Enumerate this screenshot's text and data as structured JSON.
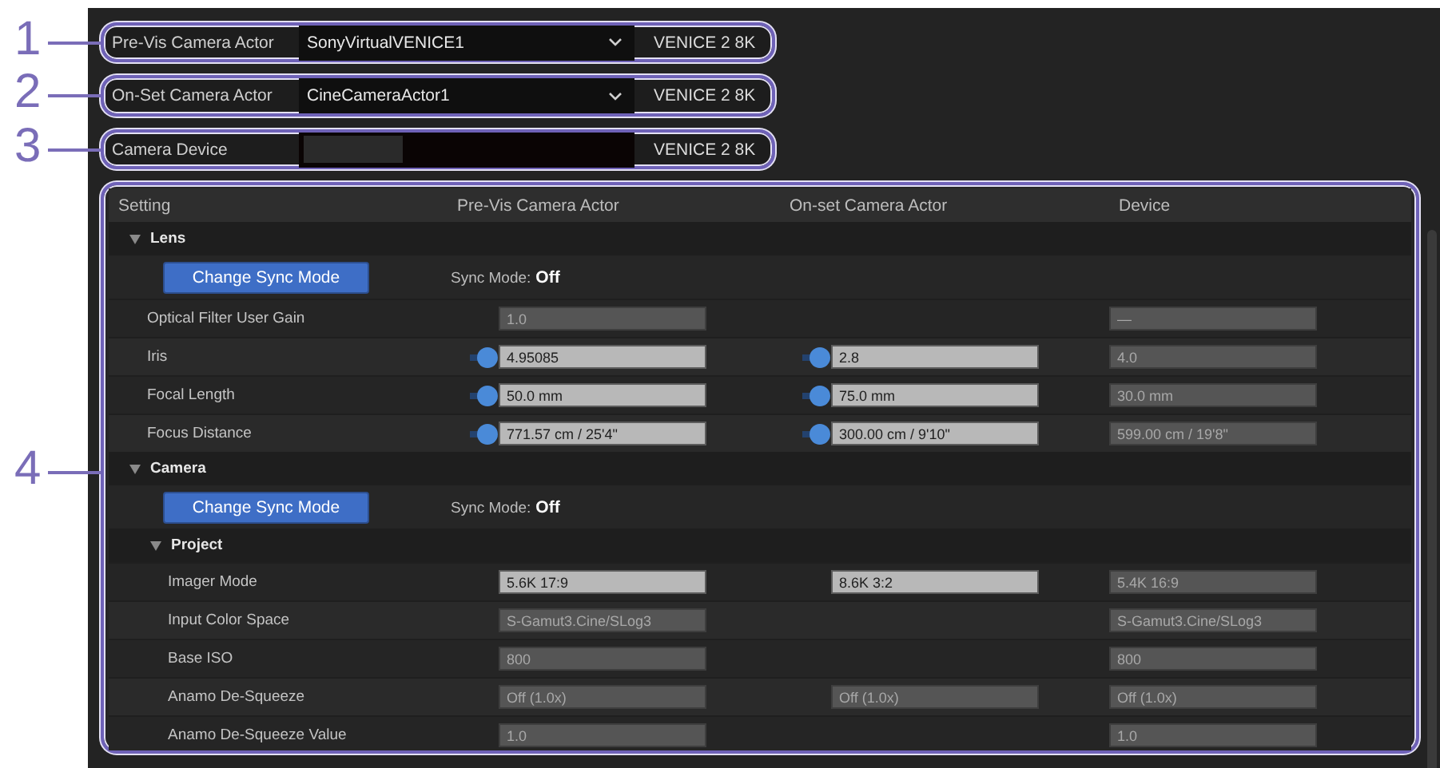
{
  "top_rows": [
    {
      "callout": "1",
      "label": "Pre-Vis Camera Actor",
      "kind": "dropdown",
      "value": "SonyVirtualVENICE1",
      "model": "VENICE 2 8K"
    },
    {
      "callout": "2",
      "label": "On-Set Camera Actor",
      "kind": "dropdown",
      "value": "CineCameraActor1",
      "model": "VENICE 2 8K"
    },
    {
      "callout": "3",
      "label": "Camera Device",
      "kind": "device_picker",
      "model": "VENICE 2 8K"
    }
  ],
  "table": {
    "callout": "4",
    "columns": [
      "Setting",
      "Pre-Vis Camera Actor",
      "On-set Camera Actor",
      "Device"
    ],
    "groups": [
      {
        "title": "Lens",
        "expanded": true,
        "items": [
          {
            "kind": "sync",
            "button": "Change Sync Mode",
            "label": "Sync Mode:",
            "value": "Off"
          },
          {
            "kind": "row",
            "label": "Optical Filter User Gain",
            "pre_vis": {
              "kind": "field",
              "value": "1.0",
              "editable": false
            },
            "device": {
              "kind": "field",
              "value": "—",
              "editable": false
            }
          },
          {
            "kind": "row",
            "label": "Iris",
            "pre_vis": {
              "kind": "slider_field",
              "value": "4.95085",
              "editable": true
            },
            "on_set": {
              "kind": "slider_field",
              "value": "2.8",
              "editable": true
            },
            "device": {
              "kind": "field",
              "value": "4.0",
              "editable": false
            }
          },
          {
            "kind": "row",
            "label": "Focal Length",
            "pre_vis": {
              "kind": "slider_field",
              "value": "50.0 mm",
              "editable": true
            },
            "on_set": {
              "kind": "slider_field",
              "value": "75.0 mm",
              "editable": true
            },
            "device": {
              "kind": "field",
              "value": "30.0 mm",
              "editable": false
            }
          },
          {
            "kind": "row",
            "label": "Focus Distance",
            "pre_vis": {
              "kind": "slider_field",
              "value": "771.57 cm / 25'4\"",
              "editable": true
            },
            "on_set": {
              "kind": "slider_field",
              "value": "300.00 cm / 9'10\"",
              "editable": true
            },
            "device": {
              "kind": "field",
              "value": "599.00 cm / 19'8\"",
              "editable": false
            }
          }
        ]
      },
      {
        "title": "Camera",
        "expanded": true,
        "items": [
          {
            "kind": "sync",
            "button": "Change Sync Mode",
            "label": "Sync Mode:",
            "value": "Off"
          },
          {
            "kind": "group",
            "title": "Project",
            "expanded": true,
            "items": [
              {
                "kind": "row",
                "label": "Imager Mode",
                "pre_vis": {
                  "kind": "field",
                  "value": "5.6K 17:9",
                  "editable": true
                },
                "on_set": {
                  "kind": "field",
                  "value": "8.6K 3:2",
                  "editable": true
                },
                "device": {
                  "kind": "field",
                  "value": "5.4K 16:9",
                  "editable": false
                }
              },
              {
                "kind": "row",
                "label": "Input Color Space",
                "pre_vis": {
                  "kind": "field",
                  "value": "S-Gamut3.Cine/SLog3",
                  "editable": false
                },
                "device": {
                  "kind": "field",
                  "value": "S-Gamut3.Cine/SLog3",
                  "editable": false
                }
              },
              {
                "kind": "row",
                "label": "Base ISO",
                "pre_vis": {
                  "kind": "field",
                  "value": "800",
                  "editable": false
                },
                "device": {
                  "kind": "field",
                  "value": "800",
                  "editable": false
                }
              },
              {
                "kind": "row",
                "label": "Anamo De-Squeeze",
                "pre_vis": {
                  "kind": "field",
                  "value": "Off (1.0x)",
                  "editable": false
                },
                "on_set": {
                  "kind": "field",
                  "value": "Off (1.0x)",
                  "editable": false
                },
                "device": {
                  "kind": "field",
                  "value": "Off (1.0x)",
                  "editable": false
                }
              },
              {
                "kind": "row",
                "label": "Anamo De-Squeeze Value",
                "pre_vis": {
                  "kind": "field",
                  "value": "1.0",
                  "editable": false
                },
                "device": {
                  "kind": "field",
                  "value": "1.0",
                  "editable": false
                }
              }
            ]
          }
        ]
      }
    ]
  }
}
